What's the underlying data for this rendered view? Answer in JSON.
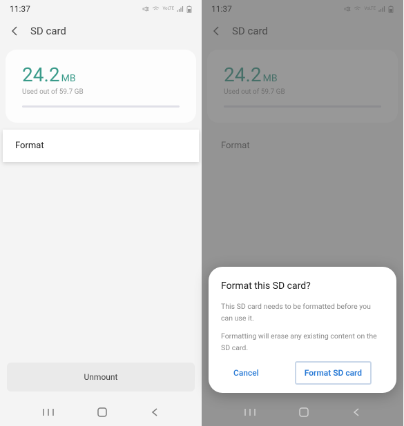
{
  "status": {
    "time": "11:37"
  },
  "header": {
    "title": "SD card"
  },
  "storage": {
    "value": "24.2",
    "unit": "MB",
    "subtext": "Used out of 59.7 GB"
  },
  "actions": {
    "format": "Format",
    "unmount": "Unmount"
  },
  "dialog": {
    "title": "Format this SD card?",
    "line1": "This SD card needs to be formatted before you can use it.",
    "line2": "Formatting will erase any existing content on the SD card.",
    "cancel": "Cancel",
    "confirm": "Format SD card"
  }
}
